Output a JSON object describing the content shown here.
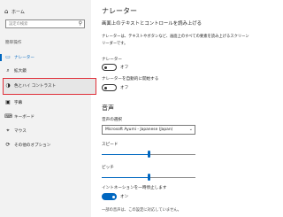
{
  "sidebar": {
    "home": {
      "icon": "home-icon",
      "label": "ホーム"
    },
    "search": {
      "placeholder": "設定の検索",
      "icon": "search-icon"
    },
    "section_label": "簡単操作",
    "items": [
      {
        "label": "ナレーター",
        "icon": "narrator-icon",
        "active": true
      },
      {
        "label": "拡大鏡",
        "icon": "magnifier-icon",
        "active": false
      },
      {
        "label": "色とハイ コントラスト",
        "icon": "contrast-icon",
        "active": false,
        "highlighted": true
      },
      {
        "label": "字幕",
        "icon": "caption-icon",
        "active": false
      },
      {
        "label": "キーボード",
        "icon": "keyboard-icon",
        "active": false
      },
      {
        "label": "マウス",
        "icon": "mouse-icon",
        "active": false
      },
      {
        "label": "その他のオプション",
        "icon": "options-icon",
        "active": false
      }
    ]
  },
  "main": {
    "title": "ナレーター",
    "subtitle": "画面上のテキストとコントロールを読み上げる",
    "description": "ナレーターは、テキストやボタンなど、画面上のすべての要素を読み上げるスクリーンリーダーです。",
    "narrator_toggle": {
      "label": "ナレーター",
      "state": "オフ",
      "on": false
    },
    "autostart_toggle": {
      "label": "ナレーターを自動的に開始する",
      "state": "オフ",
      "on": false
    },
    "voice_heading": "音声",
    "voice_select_label": "音声の選択",
    "voice_select_value": "Microsoft Ayumi - Japanese (Japan)",
    "speed_label": "スピード",
    "speed_value": 0.5,
    "pitch_label": "ピッチ",
    "pitch_value": 0.5,
    "intonation_toggle": {
      "label": "イントネーションを一時停止します",
      "state": "オン",
      "on": true
    },
    "footer_note": "一部の音声は、この設定に対応していません。"
  },
  "colors": {
    "accent": "#0067c0",
    "highlight_border": "#e0303a",
    "sidebar_bg": "#f2f2f2"
  }
}
